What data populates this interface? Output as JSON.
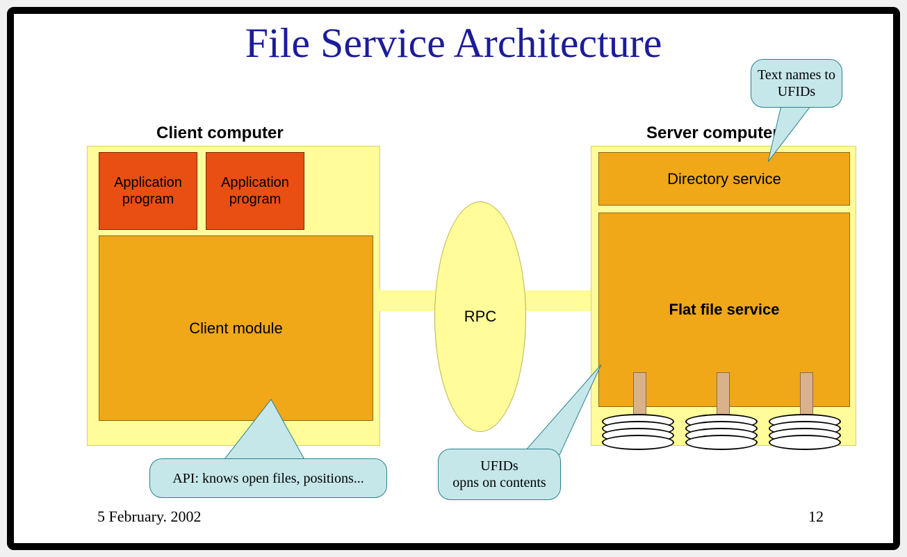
{
  "title": "File Service Architecture",
  "footer": {
    "date": "5 February. 2002",
    "page": "12"
  },
  "labels": {
    "client_computer": "Client computer",
    "server_computer": "Server computer",
    "rpc": "RPC"
  },
  "client": {
    "app1": "Application program",
    "app2": "Application program",
    "client_module": "Client module"
  },
  "server": {
    "directory_service": "Directory service",
    "flat_file_service": "Flat file service"
  },
  "callouts": {
    "api": "API: knows open files, positions...",
    "ufids": "UFIDs\nopns on contents",
    "text_names": "Text names to UFIDs"
  }
}
